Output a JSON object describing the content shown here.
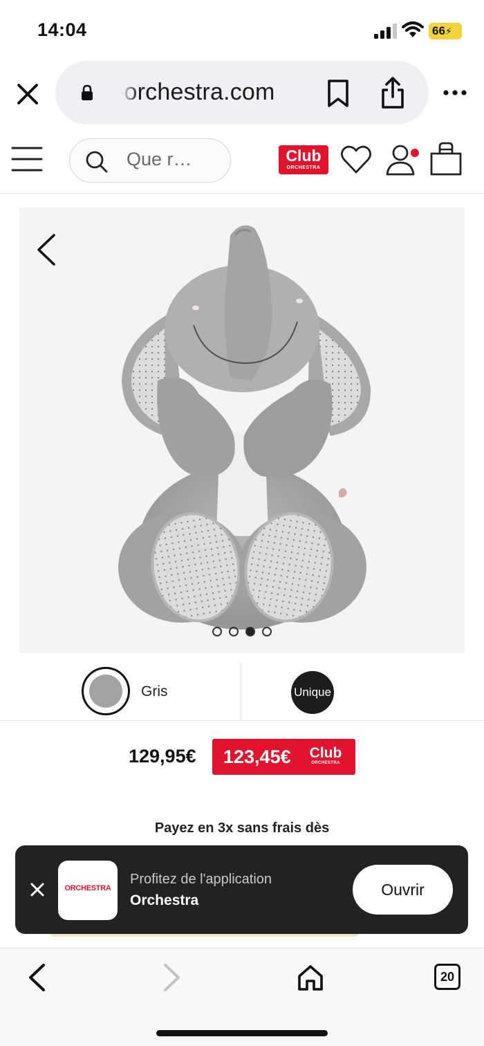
{
  "status_bar": {
    "time": "14:04",
    "battery": "66",
    "icons": [
      "signal-icon",
      "wifi-icon",
      "battery-icon"
    ]
  },
  "browser": {
    "url": "-orchestra.com",
    "icons": [
      "close-icon",
      "lock-icon",
      "bookmark-icon",
      "share-icon",
      "more-icon"
    ]
  },
  "site_header": {
    "search_placeholder": "Que r…",
    "club_logo": {
      "main": "Club",
      "sub": "ORCHESTRA"
    },
    "icons": [
      "menu-icon",
      "search-icon",
      "heart-icon",
      "account-icon",
      "bag-icon"
    ],
    "account_notification_color": "#e2142d"
  },
  "gallery": {
    "image": "grey plush elephant toy",
    "slide_count": 4,
    "active_slide": 3
  },
  "variants": {
    "color_label": "Gris",
    "color_swatch": "#a3a3a3",
    "size_label": "Unique"
  },
  "price": {
    "regular": "129,95€",
    "club": "123,45€",
    "club_badge": {
      "main": "Club",
      "sub": "ORCHESTRA"
    },
    "club_color": "#e2142d"
  },
  "installments_text": "Payez en 3x sans frais dès",
  "app_banner": {
    "icon_text": "ORCHESTRA",
    "line1": "Profitez de l'application",
    "line2": "Orchestra",
    "open_label": "Ouvrir"
  },
  "toolbar": {
    "tab_count": "20",
    "icons": [
      "back-icon",
      "forward-icon",
      "home-icon",
      "tabs-icon"
    ]
  }
}
